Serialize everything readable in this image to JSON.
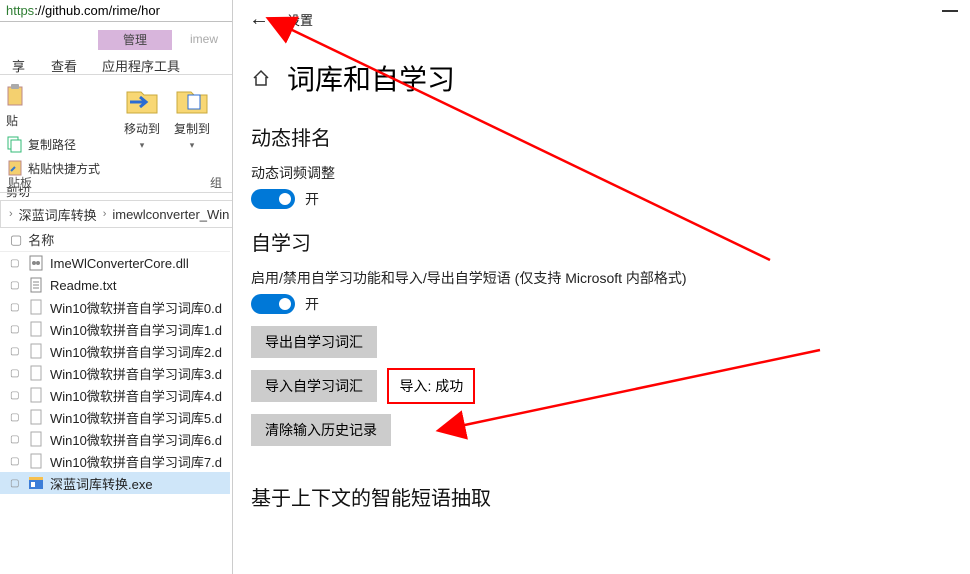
{
  "url": {
    "prefix": "https",
    "rest": "://github.com/rime/hor"
  },
  "ribbon": {
    "manage": "管理",
    "imew": "imew",
    "share": "享",
    "view": "查看",
    "appTools": "应用程序工具",
    "copyPath": "复制路径",
    "pasteShortcut": "粘贴快捷方式",
    "cut": "剪切",
    "moveTo": "移动到",
    "copyTo": "复制到",
    "groupClip": "贴板",
    "groupOrg": "组"
  },
  "breadcrumb": [
    "深蓝词库转换",
    "imewlconverter_Win"
  ],
  "fileList": {
    "colName": "名称",
    "items": [
      {
        "name": "ImeWlConverterCore.dll",
        "type": "dll"
      },
      {
        "name": "Readme.txt",
        "type": "txt"
      },
      {
        "name": "Win10微软拼音自学习词库0.d",
        "type": "dat"
      },
      {
        "name": "Win10微软拼音自学习词库1.d",
        "type": "dat"
      },
      {
        "name": "Win10微软拼音自学习词库2.d",
        "type": "dat"
      },
      {
        "name": "Win10微软拼音自学习词库3.d",
        "type": "dat"
      },
      {
        "name": "Win10微软拼音自学习词库4.d",
        "type": "dat"
      },
      {
        "name": "Win10微软拼音自学习词库5.d",
        "type": "dat"
      },
      {
        "name": "Win10微软拼音自学习词库6.d",
        "type": "dat"
      },
      {
        "name": "Win10微软拼音自学习词库7.d",
        "type": "dat"
      },
      {
        "name": "深蓝词库转换.exe",
        "type": "exe",
        "selected": true
      }
    ]
  },
  "settings": {
    "headTitle": "设置",
    "pageTitle": "词库和自学习",
    "sec1": "动态排名",
    "sec1_sub": "动态词频调整",
    "toggleOn": "开",
    "sec2": "自学习",
    "sec2_sub": "启用/禁用自学习功能和导入/导出自学短语 (仅支持 Microsoft 内部格式)",
    "btnExport": "导出自学习词汇",
    "btnImport": "导入自学习词汇",
    "importStatus": "导入: 成功",
    "btnClear": "清除输入历史记录",
    "sec3": "基于上下文的智能短语抽取"
  }
}
